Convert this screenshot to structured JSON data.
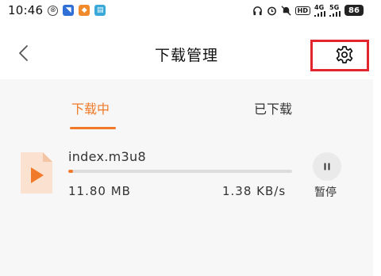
{
  "status_bar": {
    "time": "10:46",
    "battery": "86",
    "hd": "HD",
    "net_top": "4G",
    "net_bottom": "5G"
  },
  "header": {
    "title": "下载管理"
  },
  "tabs": [
    {
      "label": "下载中",
      "active": true
    },
    {
      "label": "已下载",
      "active": false
    }
  ],
  "downloads": [
    {
      "file_name": "index.m3u8",
      "size": "11.80  MB",
      "speed": "1.38  KB/s",
      "progress": 0.02,
      "action_label": "暂停"
    }
  ],
  "colors": {
    "accent": "#f07a2a",
    "highlight_box": "#e3262e",
    "content_bg": "#f7f7f7"
  },
  "icons": {
    "back": "chevron-left-icon",
    "settings": "gear-icon",
    "file": "video-file-icon",
    "pause": "pause-icon"
  }
}
